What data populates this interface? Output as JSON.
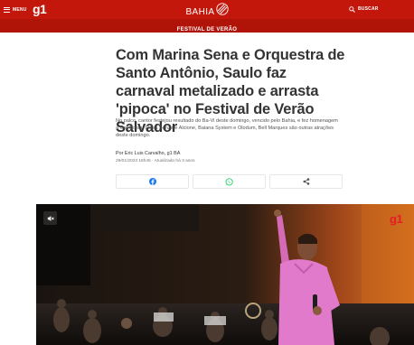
{
  "header": {
    "menu_label": "MENU",
    "logo": "g1",
    "region": "BAHIA",
    "search_label": "BUSCAR",
    "brand_color": "#c4170c",
    "icons": [
      "hamburger-icon",
      "search-icon",
      "region-mark-icon"
    ]
  },
  "section": {
    "label": "FESTIVAL DE VERÃO",
    "color": "#b01409"
  },
  "article": {
    "headline": "Com Marina Sena e Orquestra de Santo Antônio, Saulo faz carnaval metalizado e arrasta 'pipoca' no Festival de Verão Salvador",
    "summary": "No palco, cantor festejou resultado do Ba-Vi deste domingo, vencido pelo Bahia, e fez homenagem a Gal Costa. Luísa Sonza e Alcione, Baiana System e Olodum, Bell Marques são outras atrações deste domingo.",
    "byline": "Por Eric Luis Carvalho, g1 BA",
    "dateline": "29/01/2023 18h45 · Atualizado há 3 anos"
  },
  "share": {
    "icons": [
      "facebook-icon",
      "whatsapp-icon",
      "share-icon"
    ],
    "facebook_color": "#3b5998",
    "whatsapp_color": "#25d366"
  },
  "video": {
    "brand": "g1",
    "icons": [
      "mute-icon"
    ]
  }
}
